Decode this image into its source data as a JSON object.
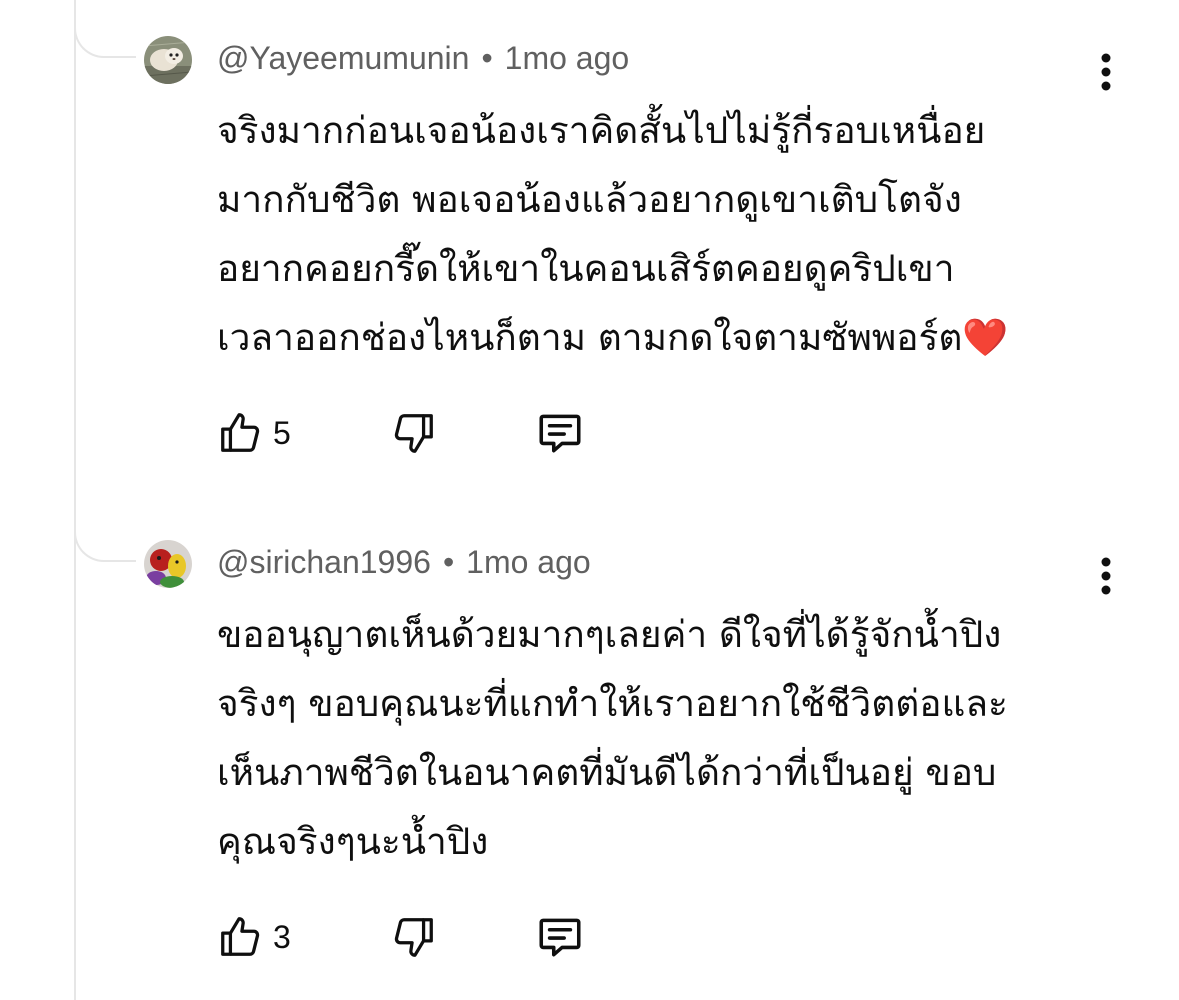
{
  "comments": [
    {
      "author": "@Yayeemumunin",
      "separator": "•",
      "time": "1mo ago",
      "text": "จริงมากก่อนเจอน้องเราคิดสั้นไปไม่รู้กี่รอบเหนื่อย\nมากกับชีวิต พอเจอน้องแล้วอยากดูเขาเติบโตจัง\nอยากคอยกรี๊ดให้เขาในคอนเสิร์ตคอยดูคริปเขา\nเวลาออกช่องไหนก็ตาม ตามกดใจตามซัพพอร์ต❤️",
      "likes": "5",
      "avatar_icon": "avatar-photo-icon"
    },
    {
      "author": "@sirichan1996",
      "separator": "•",
      "time": "1mo ago",
      "text": "ขออนุญาตเห็นด้วยมากๆเลยค่า ดีใจที่ได้รู้จักน้ำปิง\nจริงๆ ขอบคุณนะที่แกทำให้เราอยากใช้ชีวิตต่อและ\nเห็นภาพชีวิตในอนาคตที่มันดีได้กว่าที่เป็นอยู่ ขอบ\nคุณจริงๆนะน้ำปิง",
      "likes": "3",
      "avatar_icon": "avatar-photo-icon"
    }
  ],
  "icons": {
    "like": "thumbs-up-icon",
    "dislike": "thumbs-down-icon",
    "reply": "reply-icon",
    "more": "more-vertical-icon"
  },
  "colors": {
    "text": "#0f0f0f",
    "meta": "#606060",
    "thread": "#e6e6e6"
  }
}
